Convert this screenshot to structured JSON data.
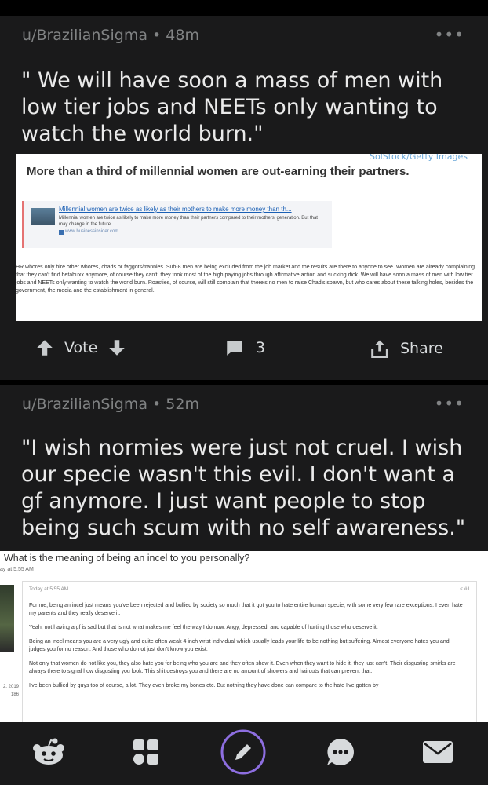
{
  "posts": [
    {
      "meta": "u/BrazilianSigma • 48m",
      "more": "•••",
      "title": "\" We will have soon a mass of men with low tier jobs and NEETs only wanting to watch the world burn.\"",
      "image": {
        "credit": "SolStock/Getty Images",
        "headline": "More than a third of millennial women are out-earning their partners.",
        "quote_title": "Millennial women are twice as likely as their mothers to make more money than th...",
        "quote_desc": "Millennial women are twice as likely to make more money than their partners compared to their mothers' generation. But that may change in the future.",
        "quote_source": "www.businessinsider.com",
        "paragraph": "HR whores only hire other whores, chads or faggots/trannies. Sub-8 men are being excluded from the job market and the results are there to anyone to see. Women are already complaining that they can't find betabuxx anymore, of course they can't, they took most of the high paying jobs through affirmative action and sucking dick. We will have soon a mass of men with low tier jobs and NEETs only wanting to watch the world burn. Roasties, of course, will still complain that there's no men to raise Chad's spawn, but who cares about these talking holes, besides the government, the media and the establishment in general."
      },
      "actions": {
        "vote": "Vote",
        "comments": "3",
        "share": "Share"
      }
    },
    {
      "meta": "u/BrazilianSigma • 52m",
      "more": "•••",
      "title": "\"I wish normies were just not cruel. I wish our specie wasn't this evil. I don't want a gf anymore. I just want people to stop being such scum with no self awareness.\"",
      "image": {
        "thread_title": "What is the meaning of being an incel to you personally?",
        "thread_date": "ay at 5:55 AM",
        "post_date": "Today at 5:55 AM",
        "post_number": "< #1",
        "side_meta_1": "2, 2019",
        "side_meta_2": "186",
        "paragraphs": [
          "For me, being an incel just means you've been rejected and bullied by society so much that it got you to hate entire human specie, with some very few rare exceptions. I even hate my parents and they really deserve it.",
          "Yeah, not having a gf is sad but that is not what makes me feel the way I do now. Angy, depressed, and capable of hurting those who deserve it.",
          "Being an incel means you are a very ugly and quite often weak 4 inch wrist individual which usually leads your life to be nothing but suffering. Almost everyone hates you and judges you for no reason. And those who do not just don't know you exist.",
          "Not only that women do not like you, they also hate you for being who you are and they often show it. Even when they want to hide it, they just can't. Their disgusting smirks are always there to signal how disgusting you look. This shit destroys you and there are no amount of showers and haircuts that can prevent that.",
          "I've been bullied by guys too of course, a lot. They even broke my bones etc. But nothing they have done can compare to the hate I've gotten by"
        ]
      }
    }
  ],
  "tabbar": {
    "icons": [
      "reddit-home-icon",
      "communities-grid-icon",
      "create-post-pencil-icon",
      "chat-bubble-icon",
      "inbox-mail-icon"
    ],
    "accent": "#8d6ee0"
  }
}
